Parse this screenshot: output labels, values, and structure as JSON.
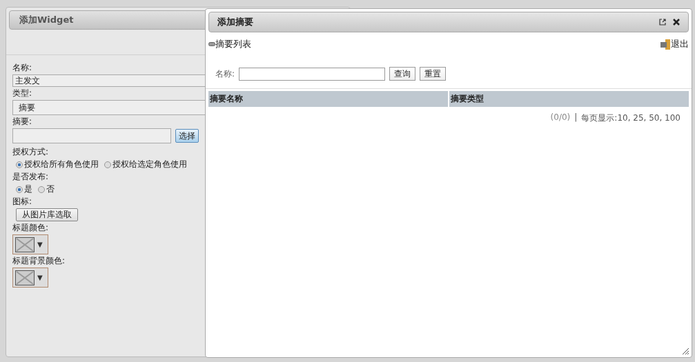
{
  "widget_dialog": {
    "title": "添加Widget",
    "name": {
      "label": "名称:",
      "value": "主发文"
    },
    "type": {
      "label": "类型:",
      "value": "摘要"
    },
    "summary": {
      "label": "摘要:",
      "button": "选择"
    },
    "auth": {
      "label": "授权方式:",
      "options": [
        {
          "label": "授权给所有角色使用",
          "selected": true
        },
        {
          "label": "授权给选定角色使用",
          "selected": false
        }
      ]
    },
    "publish": {
      "label": "是否发布:",
      "options": [
        {
          "label": "是",
          "selected": true
        },
        {
          "label": "否",
          "selected": false
        }
      ]
    },
    "icon": {
      "label": "图标:",
      "button": "从图片库选取"
    },
    "title_color": {
      "label": "标题颜色:",
      "arrow": "▼"
    },
    "title_bg_color": {
      "label": "标题背景颜色:",
      "arrow": "▼"
    }
  },
  "summary_dialog": {
    "title": "添加摘要",
    "list_title": "摘要列表",
    "exit": "退出",
    "search": {
      "label": "名称:",
      "query_button": "查询",
      "reset_button": "重置"
    },
    "table": {
      "columns": [
        "摘要名称",
        "摘要类型"
      ]
    },
    "pager": {
      "count": "(0/0)",
      "separator": "|",
      "page_size": "每页显示:10, 25, 50, 100"
    }
  }
}
